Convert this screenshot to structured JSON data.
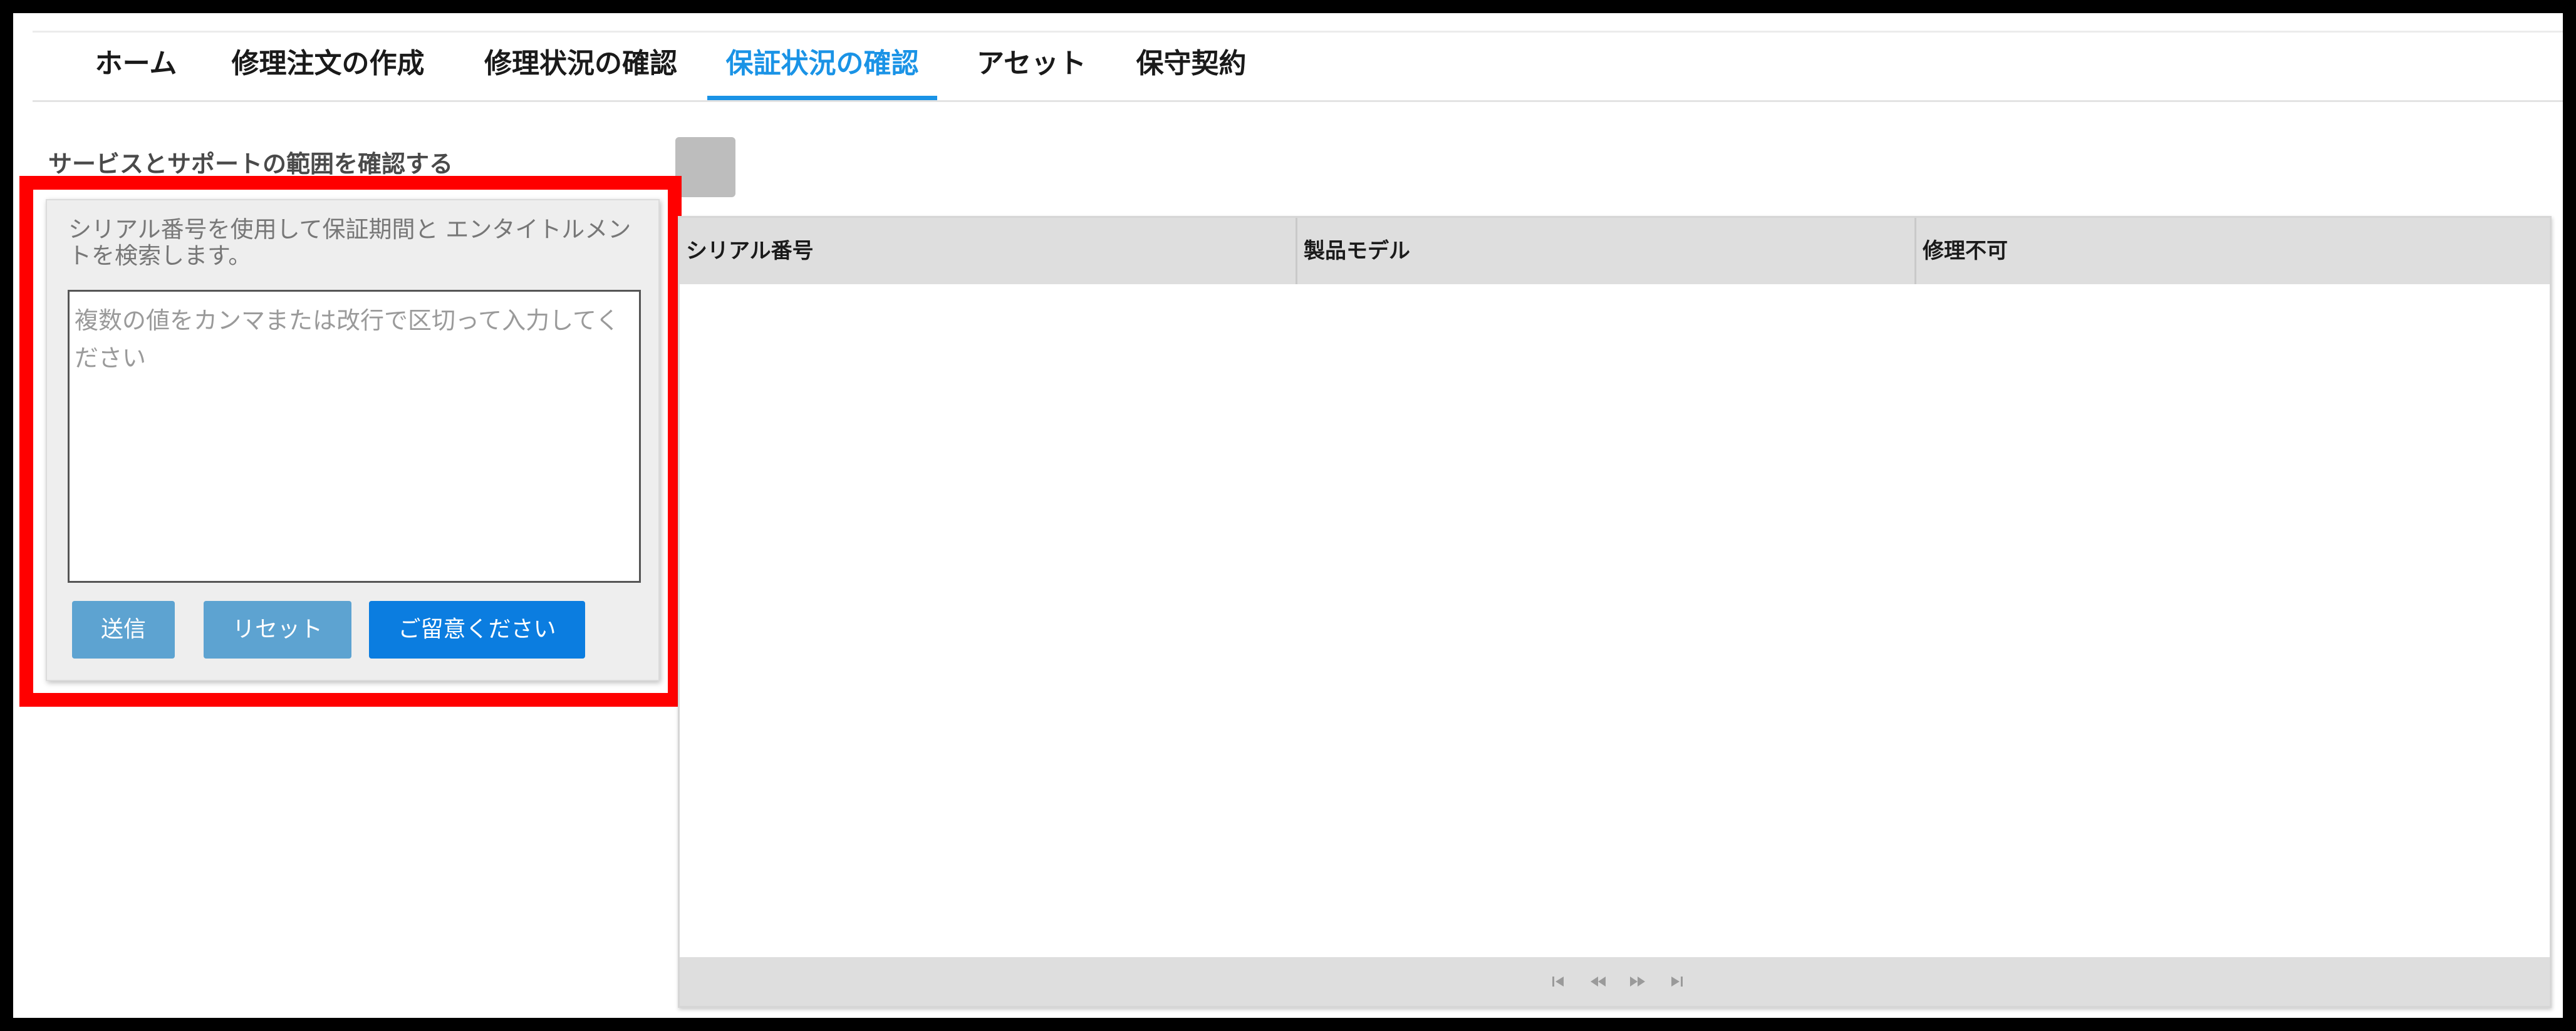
{
  "nav": {
    "tabs": [
      {
        "label": "ホーム"
      },
      {
        "label": "修理注文の作成"
      },
      {
        "label": "修理状況の確認"
      },
      {
        "label": "保証状況の確認"
      },
      {
        "label": "アセット"
      },
      {
        "label": "保守契約"
      }
    ],
    "active_index": 3
  },
  "scope": {
    "title": "サービスとサポートの範囲を確認する"
  },
  "panel": {
    "description": "シリアル番号を使用して保証期間と エンタイトルメントを検索します。",
    "input_placeholder": "複数の値をカンマまたは改行で区切って入力してください",
    "input_value": "",
    "buttons": {
      "send": "送信",
      "reset": "リセット",
      "notice": "ご留意ください"
    }
  },
  "grid": {
    "columns": [
      "シリアル番号",
      "製品モデル",
      "修理不可"
    ],
    "rows": []
  },
  "pager_icons": [
    "first-page-icon",
    "prev-page-icon",
    "next-page-icon",
    "last-page-icon"
  ],
  "colors": {
    "accent": "#1a93e6",
    "button": "#5da3d1",
    "button_primary": "#0b7de0",
    "highlight": "#ff0000"
  }
}
